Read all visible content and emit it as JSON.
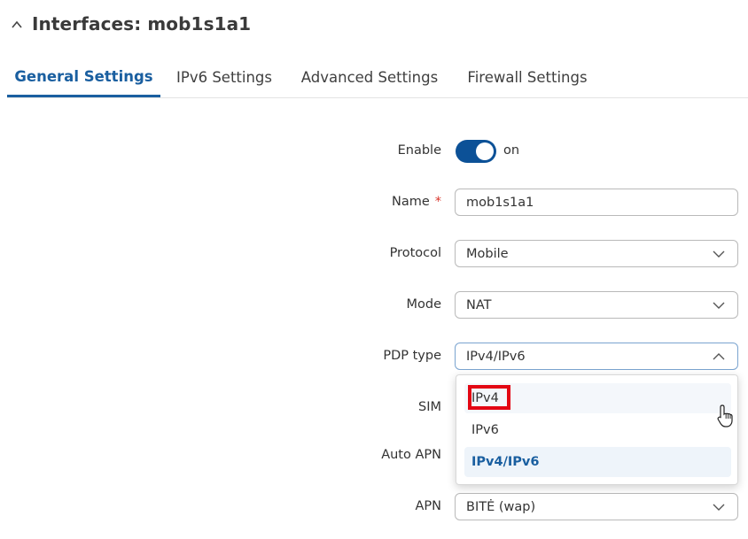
{
  "header": {
    "title": "Interfaces: mob1s1a1",
    "collapse_icon": "chevron-up-icon"
  },
  "tabs": [
    {
      "label": "General Settings",
      "active": true
    },
    {
      "label": "IPv6 Settings",
      "active": false
    },
    {
      "label": "Advanced Settings",
      "active": false
    },
    {
      "label": "Firewall Settings",
      "active": false
    }
  ],
  "form": {
    "enable": {
      "label": "Enable",
      "value": "on",
      "checked": true
    },
    "name": {
      "label": "Name",
      "required_mark": "*",
      "value": "mob1s1a1"
    },
    "protocol": {
      "label": "Protocol",
      "value": "Mobile"
    },
    "mode": {
      "label": "Mode",
      "value": "NAT"
    },
    "pdp_type": {
      "label": "PDP type",
      "value": "IPv4/IPv6",
      "open": true,
      "options": [
        "IPv4",
        "IPv6",
        "IPv4/IPv6"
      ],
      "selected": "IPv4/IPv6",
      "hovered": "IPv4"
    },
    "sim": {
      "label": "SIM"
    },
    "auto_apn": {
      "label": "Auto APN"
    },
    "apn": {
      "label": "APN",
      "value": "BITĖ (wap)"
    }
  },
  "colors": {
    "accent": "#1a5fa0",
    "toggle_on": "#0c5197",
    "annotation": "#e30613"
  }
}
